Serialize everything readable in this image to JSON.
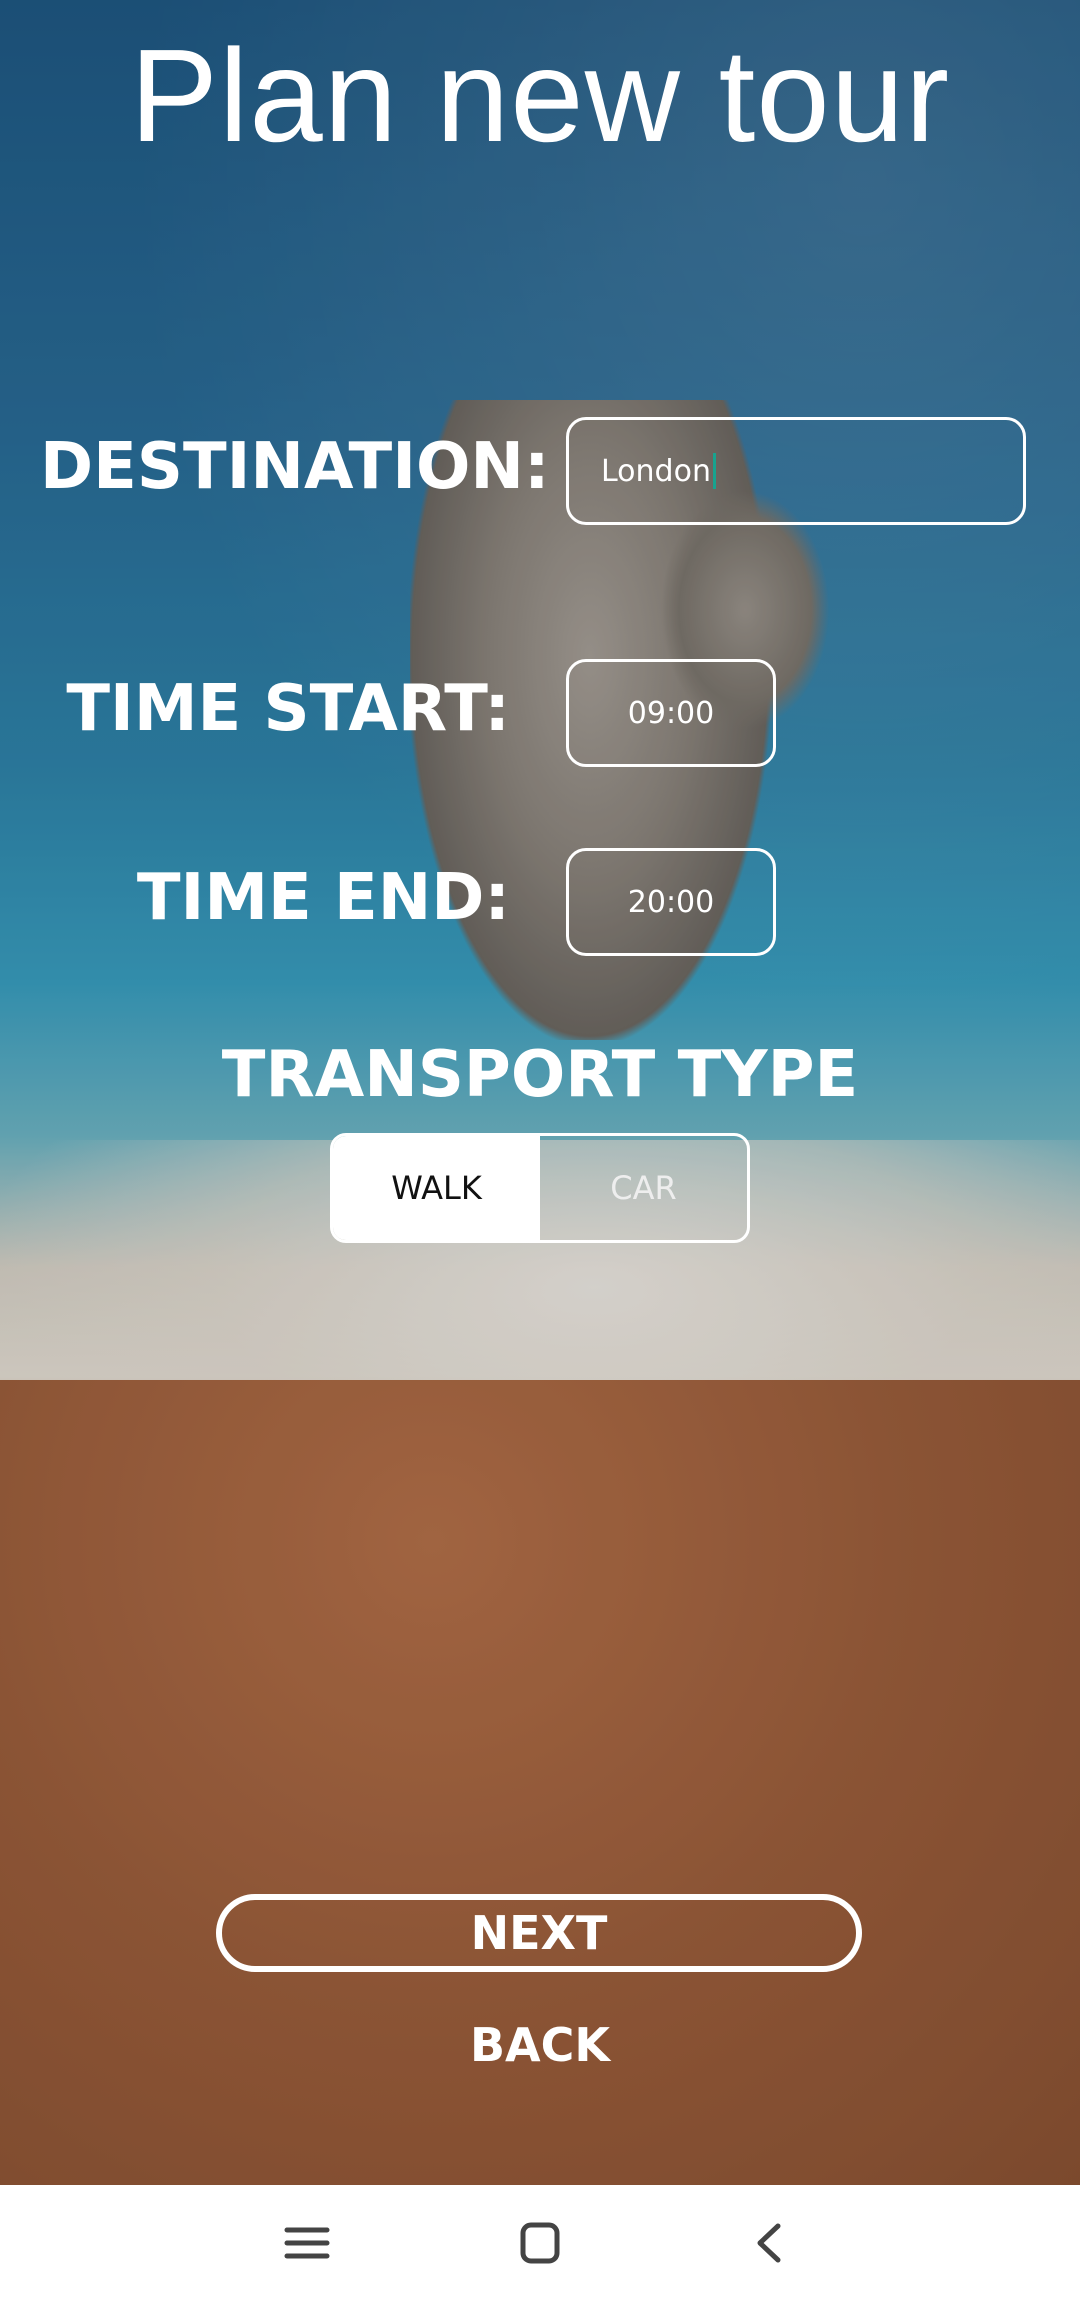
{
  "title": "Plan new tour",
  "form": {
    "destination": {
      "label": "DESTINATION:",
      "value": "London"
    },
    "time_start": {
      "label": "TIME START:",
      "value": "09:00"
    },
    "time_end": {
      "label": "TIME END:",
      "value": "20:00"
    }
  },
  "transport": {
    "title": "TRANSPORT TYPE",
    "options": [
      "WALK",
      "CAR"
    ],
    "selected": "WALK"
  },
  "buttons": {
    "next": "NEXT",
    "back": "BACK"
  },
  "navbar": {
    "icons": [
      "menu-icon",
      "home-icon",
      "back-icon"
    ]
  },
  "colors": {
    "caret": "#17a38f",
    "nav_icon": "#444444"
  }
}
